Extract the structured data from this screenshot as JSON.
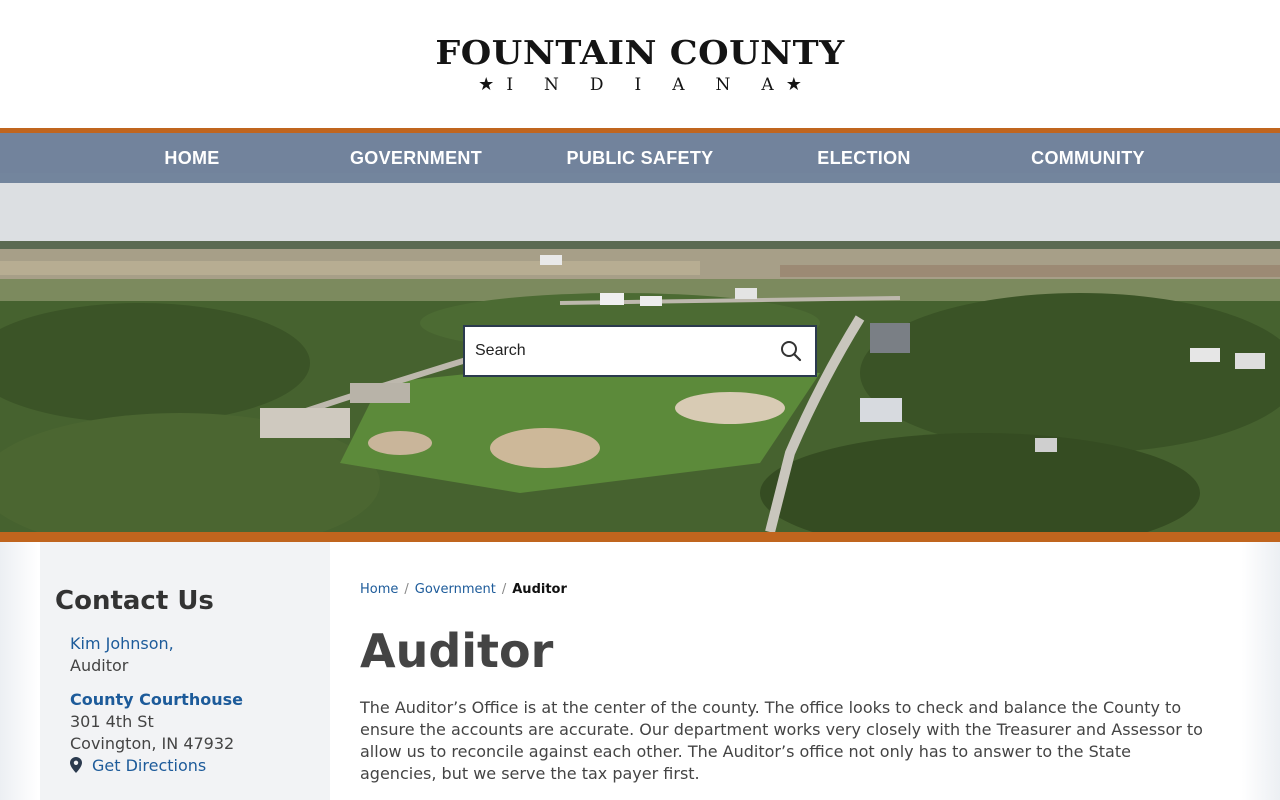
{
  "header": {
    "logo_title": "FOUNTAIN COUNTY",
    "logo_subtitle": "INDIANA"
  },
  "nav": {
    "items": [
      {
        "label": "HOME"
      },
      {
        "label": "GOVERNMENT"
      },
      {
        "label": "PUBLIC SAFETY"
      },
      {
        "label": "ELECTION"
      },
      {
        "label": "COMMUNITY"
      }
    ]
  },
  "search": {
    "placeholder": "Search",
    "icon": "search-icon"
  },
  "sidebar": {
    "heading": "Contact Us",
    "contact_name": "Kim Johnson,",
    "contact_role": "Auditor",
    "location_name": "County Courthouse",
    "address_line1": "301 4th St",
    "address_line2": "Covington, IN 47932",
    "directions_label": "Get Directions",
    "directions_icon": "map-pin-icon"
  },
  "breadcrumb": {
    "items": [
      "Home",
      "Government"
    ],
    "current": "Auditor"
  },
  "main": {
    "title": "Auditor",
    "intro": "The Auditor’s Office is at the center of the county. The office looks to check and balance the County to ensure the accounts are accurate. Our department works very closely with the Treasurer and Assessor to allow us to reconcile against each other. The Auditor’s office not only has to answer to the State agencies, but we serve the tax payer first."
  },
  "colors": {
    "accent_orange": "#c0651e",
    "nav_bg": "#627692",
    "link_blue": "#1d5b9a"
  }
}
